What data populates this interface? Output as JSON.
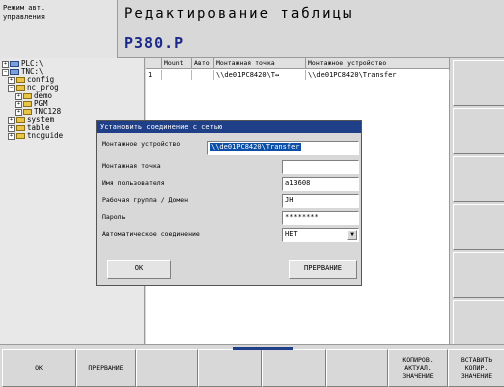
{
  "header": {
    "mode_line1": "Режим авт.",
    "mode_line2": "управления",
    "title": "Редактирование таблицы",
    "file": "P380.P"
  },
  "tree": [
    {
      "label": "PLC:\\",
      "icon": "pc"
    },
    {
      "label": "TNC:\\",
      "icon": "pc"
    },
    {
      "label": "config",
      "icon": "folder"
    },
    {
      "label": "nc_prog",
      "icon": "folder"
    },
    {
      "label": "demo",
      "icon": "folder"
    },
    {
      "label": "PGM",
      "icon": "folder"
    },
    {
      "label": "TNC128",
      "icon": "folder"
    },
    {
      "label": "system",
      "icon": "folder"
    },
    {
      "label": "table",
      "icon": "folder"
    },
    {
      "label": "tncguide",
      "icon": "folder"
    }
  ],
  "table": {
    "columns": [
      "",
      "Mount",
      "Авто",
      "Монтажная точка",
      "Монтажное устройство"
    ],
    "rows": [
      [
        "1",
        "",
        "",
        "\\\\de01PC8420\\T↔",
        "\\\\de01PC8420\\Transfer"
      ]
    ]
  },
  "dialog": {
    "title": "Установить соединение с сетью",
    "fields": [
      {
        "label": "Монтажное устройство",
        "value": "\\\\de01PC8420\\Transfer"
      },
      {
        "label": "Монтажная точка",
        "value": ""
      },
      {
        "label": "Имя пользователя",
        "value": "a13608"
      },
      {
        "label": "Рабочая группа / Домен",
        "value": "JH"
      },
      {
        "label": "Пароль",
        "value": "********"
      },
      {
        "label": "Автоматическое соединение",
        "value": "НЕТ"
      }
    ],
    "ok_label": "OK",
    "cancel_label": "ПРЕРВАНИЕ"
  },
  "softkeys": {
    "ok": "OK",
    "cancel": "ПРЕРВАНИЕ",
    "copy": "КОПИРОВ.\nАКТУАЛ.\nЗНАЧЕНИЕ",
    "paste": "ВСТАВИТЬ\nКОПИР.\nЗНАЧЕНИЕ"
  }
}
